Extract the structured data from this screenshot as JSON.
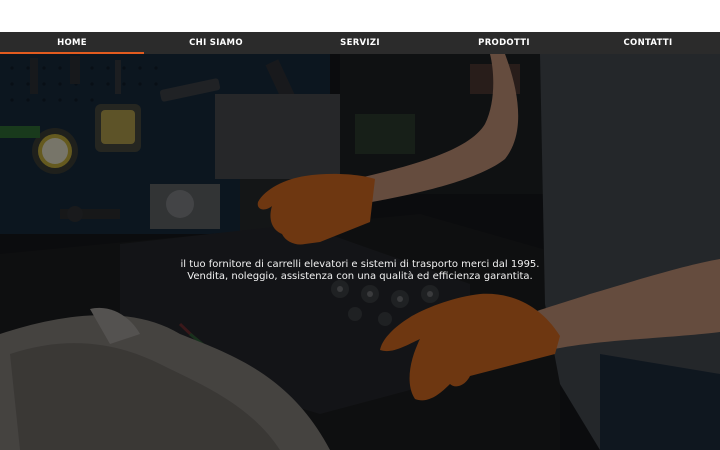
{
  "nav": {
    "items": [
      {
        "label": "HOME",
        "active": true
      },
      {
        "label": "CHI SIAMO",
        "active": false
      },
      {
        "label": "SERVIZI",
        "active": false
      },
      {
        "label": "PRODOTTI",
        "active": false
      },
      {
        "label": "CONTATTI",
        "active": false
      }
    ]
  },
  "hero": {
    "line1": "il tuo fornitore di carrelli elevatori e sistemi di trasporto merci dal 1995.",
    "line2": "Vendita, noleggio, assistenza con una qualità ed efficienza garantita."
  },
  "colors": {
    "nav_bg": "#2b2b2b",
    "accent": "#e25b1f",
    "glove": "#c9651f"
  }
}
